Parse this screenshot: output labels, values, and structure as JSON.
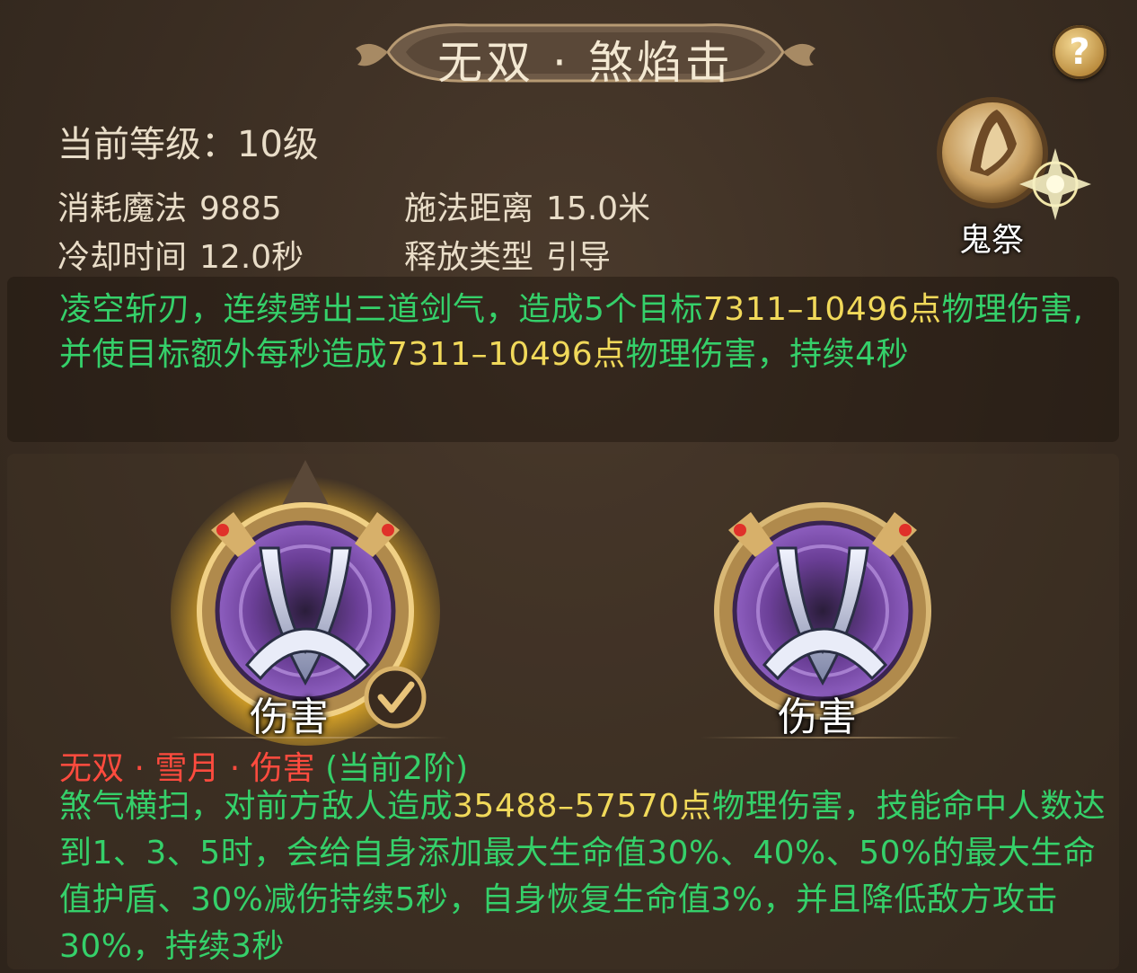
{
  "title": "无双 · 煞焰击",
  "help_label": "?",
  "stats": {
    "level_label": "当前等级：",
    "level_value": "10级",
    "mana_label": "消耗魔法",
    "mana_value": "9885",
    "range_label": "施法距离",
    "range_value": "15.0米",
    "cooldown_label": "冷却时间",
    "cooldown_value": "12.0秒",
    "cast_type_label": "释放类型",
    "cast_type_value": "引导"
  },
  "class_emblem": {
    "label": "鬼祭",
    "icon": "hooded-figure-icon"
  },
  "description": {
    "p1": "凌空斩刃，连续劈出三道剑气，造成5个目标",
    "dmg1": "7311–10496点",
    "p2": "物理伤害,并使目标额外每秒造成",
    "dmg2": "7311–10496点",
    "p3": "物理伤害，持续4秒"
  },
  "variants": [
    {
      "label": "伤害",
      "selected": true,
      "icon": "crossed-blades-badge-icon"
    },
    {
      "label": "伤害",
      "selected": false,
      "icon": "crossed-blades-badge-icon"
    }
  ],
  "selected_variant": {
    "name": "无双 · 雪月 · 伤害",
    "stage": "(当前2阶)",
    "p1": "煞气横扫，对前方敌人造成",
    "dmg": "35488–57570点",
    "p2": "物理伤害，技能命中人数达到1、3、5时，会给自身添加最大生命值30%、40%、50%的最大生命值护盾、30%减伤持续5秒，自身恢复生命值3%，并且降低敌方攻击30%，持续3秒"
  },
  "colors": {
    "green_text": "#35d06a",
    "yellow_text": "#f1d95a",
    "red_title": "#ff4b3e",
    "cream_text": "#e9ddc8"
  }
}
